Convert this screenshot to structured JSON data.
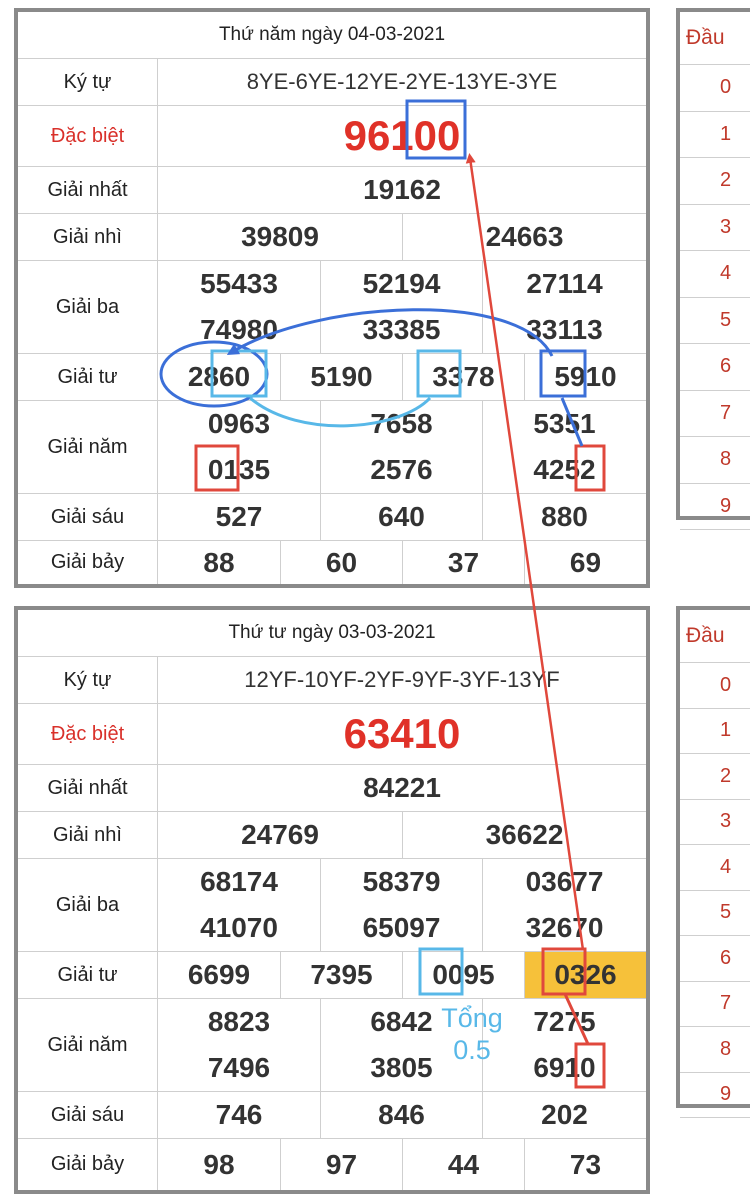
{
  "draw1": {
    "header": "Thứ năm ngày 04-03-2021",
    "labels": [
      "Ký tự",
      "Đặc biệt",
      "Giải nhất",
      "Giải nhì",
      "Giải ba",
      "Giải tư",
      "Giải năm",
      "Giải sáu",
      "Giải bảy"
    ],
    "ky_tu": "8YE-6YE-12YE-2YE-13YE-3YE",
    "dac_biet": "96100",
    "nhat": "19162",
    "nhi": [
      "39809",
      "24663"
    ],
    "ba": [
      "55433",
      "52194",
      "27114",
      "74980",
      "33385",
      "33113"
    ],
    "tu": [
      "2860",
      "5190",
      "3378",
      "5910"
    ],
    "nam": [
      "0963",
      "7658",
      "5351",
      "0135",
      "2576",
      "4252"
    ],
    "sau": [
      "527",
      "640",
      "880"
    ],
    "bay": [
      "88",
      "60",
      "37",
      "69"
    ]
  },
  "draw2": {
    "header": "Thứ tư ngày 03-03-2021",
    "labels": [
      "Ký tự",
      "Đặc biệt",
      "Giải nhất",
      "Giải nhì",
      "Giải ba",
      "Giải tư",
      "Giải năm",
      "Giải sáu",
      "Giải bảy"
    ],
    "ky_tu": "12YF-10YF-2YF-9YF-3YF-13YF",
    "dac_biet": "63410",
    "nhat": "84221",
    "nhi": [
      "24769",
      "36622"
    ],
    "ba": [
      "68174",
      "58379",
      "03677",
      "41070",
      "65097",
      "32670"
    ],
    "tu": [
      "6699",
      "7395",
      "0095",
      "0326"
    ],
    "nam": [
      "8823",
      "6842",
      "7275",
      "7496",
      "3805",
      "6910"
    ],
    "sau": [
      "746",
      "846",
      "202"
    ],
    "bay": [
      "98",
      "97",
      "44",
      "73"
    ]
  },
  "side": {
    "header": "Đầu",
    "digits": [
      "0",
      "1",
      "2",
      "3",
      "4",
      "5",
      "6",
      "7",
      "8",
      "9"
    ]
  },
  "annotation": {
    "line1": "Tổng",
    "line2": "0.5"
  },
  "colors": {
    "red_text": "#e03128",
    "highlight": "#f6c13a",
    "box_red": "#e0483c",
    "box_blue": "#3b6fd8",
    "box_cyan": "#58b8e8"
  }
}
